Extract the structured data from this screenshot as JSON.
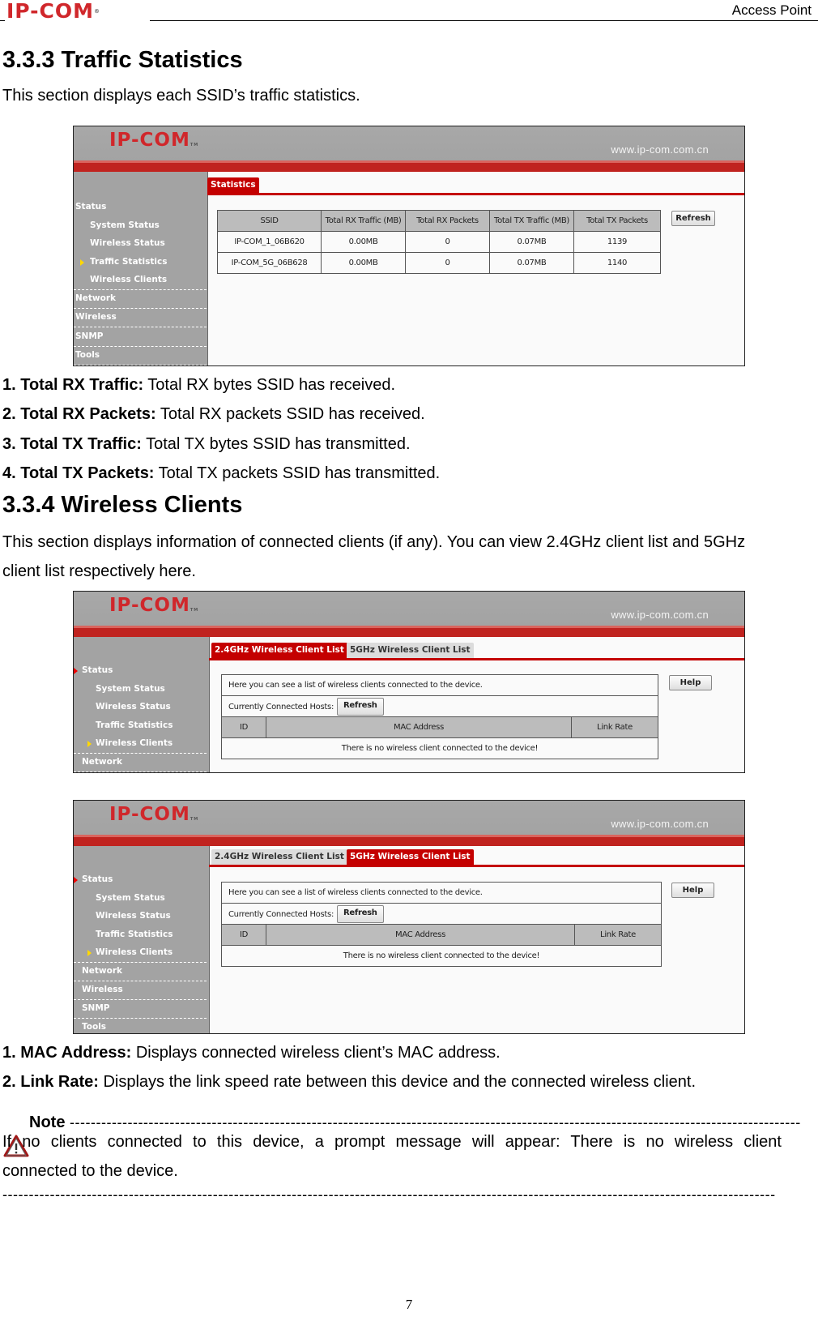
{
  "page_header": {
    "logo": "IP-COM",
    "registered_mark": "®",
    "doc_title": "Access Point"
  },
  "section_333": {
    "heading": "3.3.3 Traffic Statistics",
    "intro": "This section displays each SSID’s traffic statistics."
  },
  "router_ui": {
    "logo": "IP-COM",
    "tm": "TM",
    "url": "www.ip-com.com.cn",
    "sidebar": {
      "status": "Status",
      "system_status": "System Status",
      "wireless_status": "Wireless Status",
      "traffic_statistics": "Traffic Statistics",
      "wireless_clients": "Wireless Clients",
      "network": "Network",
      "wireless": "Wireless",
      "snmp": "SNMP",
      "tools": "Tools"
    }
  },
  "stats_screen": {
    "tab": "Statistics",
    "refresh": "Refresh",
    "columns": [
      "SSID",
      "Total RX Traffic (MB)",
      "Total RX Packets",
      "Total TX Traffic (MB)",
      "Total TX Packets"
    ],
    "rows": [
      [
        "IP-COM_1_06B620",
        "0.00MB",
        "0",
        "0.07MB",
        "1139"
      ],
      [
        "IP-COM_5G_06B628",
        "0.00MB",
        "0",
        "0.07MB",
        "1140"
      ]
    ]
  },
  "field_defs_1": [
    {
      "term": "1. Total RX Traffic:",
      "desc": " Total RX bytes SSID has received."
    },
    {
      "term": "2. Total RX Packets:",
      "desc": " Total RX packets SSID has received."
    },
    {
      "term": "3. Total TX Traffic:",
      "desc": " Total TX bytes SSID has transmitted."
    },
    {
      "term": "4. Total TX Packets:",
      "desc": " Total TX packets SSID has transmitted."
    }
  ],
  "section_334": {
    "heading": "3.3.4 Wireless Clients",
    "intro_line1": "This section displays information of connected clients (if any). You can view 2.4GHz client list and 5GHz",
    "intro_line2": "client list respectively here."
  },
  "clients_screen": {
    "tab_24": "2.4GHz Wireless Client List",
    "tab_5": "5GHz Wireless Client List",
    "help": "Help",
    "description": "Here you can see a list of wireless clients connected to the device.",
    "hosts_label": "Currently Connected Hosts:",
    "refresh": "Refresh",
    "columns": [
      "ID",
      "MAC Address",
      "Link Rate"
    ],
    "empty_message": "There is no wireless client connected to the device!"
  },
  "field_defs_2": [
    {
      "term": "1. MAC Address:",
      "desc": " Displays connected wireless client’s MAC address."
    },
    {
      "term": "2. Link Rate:",
      "desc": " Displays the link speed rate between this device and the connected wireless client."
    }
  ],
  "note": {
    "label": "Note",
    "dashes": "-------------------------------------------------------------------------------------------------------------------------------------------",
    "line1": "If no clients connected to this device, a prompt message will appear: There is no wireless client",
    "line2": "connected to the device.",
    "end_dashes": "---------------------------------------------------------------------------------------------------------------------------------------------------"
  },
  "page_number": "7"
}
